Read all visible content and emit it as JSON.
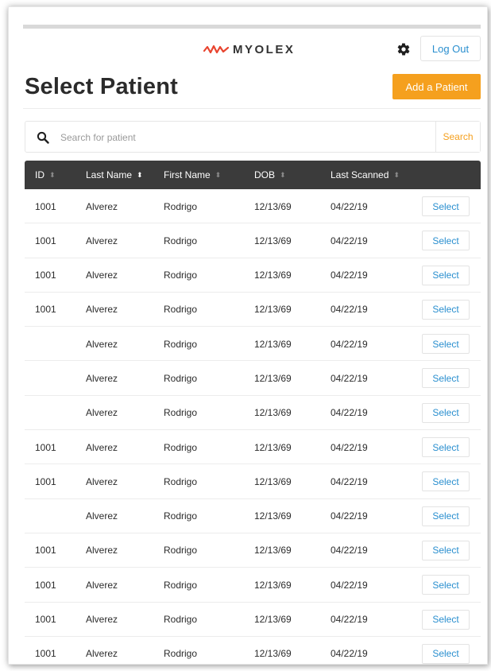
{
  "header": {
    "logo_text": "MYOLEX",
    "logout_label": "Log Out"
  },
  "page": {
    "title": "Select Patient",
    "add_label": "Add a Patient"
  },
  "search": {
    "placeholder": "Search for patient",
    "button_label": "Search"
  },
  "table": {
    "columns": [
      {
        "label": "ID",
        "sort": "none"
      },
      {
        "label": "Last Name",
        "sort": "active"
      },
      {
        "label": "First Name",
        "sort": "none"
      },
      {
        "label": "DOB",
        "sort": "none"
      },
      {
        "label": "Last Scanned",
        "sort": "none"
      }
    ],
    "select_label": "Select",
    "rows": [
      {
        "id": "1001",
        "last": "Alverez",
        "first": "Rodrigo",
        "dob": "12/13/69",
        "scanned": "04/22/19"
      },
      {
        "id": "1001",
        "last": "Alverez",
        "first": "Rodrigo",
        "dob": "12/13/69",
        "scanned": "04/22/19"
      },
      {
        "id": "1001",
        "last": "Alverez",
        "first": "Rodrigo",
        "dob": "12/13/69",
        "scanned": "04/22/19"
      },
      {
        "id": "1001",
        "last": "Alverez",
        "first": "Rodrigo",
        "dob": "12/13/69",
        "scanned": "04/22/19"
      },
      {
        "id": "",
        "last": "Alverez",
        "first": "Rodrigo",
        "dob": "12/13/69",
        "scanned": "04/22/19"
      },
      {
        "id": "",
        "last": "Alverez",
        "first": "Rodrigo",
        "dob": "12/13/69",
        "scanned": "04/22/19"
      },
      {
        "id": "",
        "last": "Alverez",
        "first": "Rodrigo",
        "dob": "12/13/69",
        "scanned": "04/22/19"
      },
      {
        "id": "1001",
        "last": "Alverez",
        "first": "Rodrigo",
        "dob": "12/13/69",
        "scanned": "04/22/19"
      },
      {
        "id": "1001",
        "last": "Alverez",
        "first": "Rodrigo",
        "dob": "12/13/69",
        "scanned": "04/22/19"
      },
      {
        "id": "",
        "last": "Alverez",
        "first": "Rodrigo",
        "dob": "12/13/69",
        "scanned": "04/22/19"
      },
      {
        "id": "1001",
        "last": "Alverez",
        "first": "Rodrigo",
        "dob": "12/13/69",
        "scanned": "04/22/19"
      },
      {
        "id": "1001",
        "last": "Alverez",
        "first": "Rodrigo",
        "dob": "12/13/69",
        "scanned": "04/22/19"
      },
      {
        "id": "1001",
        "last": "Alverez",
        "first": "Rodrigo",
        "dob": "12/13/69",
        "scanned": "04/22/19"
      },
      {
        "id": "1001",
        "last": "Alverez",
        "first": "Rodrigo",
        "dob": "12/13/69",
        "scanned": "04/22/19"
      }
    ]
  },
  "icons": {
    "logo": "pulse-wave-icon",
    "settings": "gear-icon",
    "search": "search-icon",
    "sort": "sort-arrows-icon"
  },
  "colors": {
    "accent": "#f5a01e",
    "link": "#2a8fcf",
    "header_bg": "#3b3b3b",
    "logo_wave": "#e8442f"
  }
}
